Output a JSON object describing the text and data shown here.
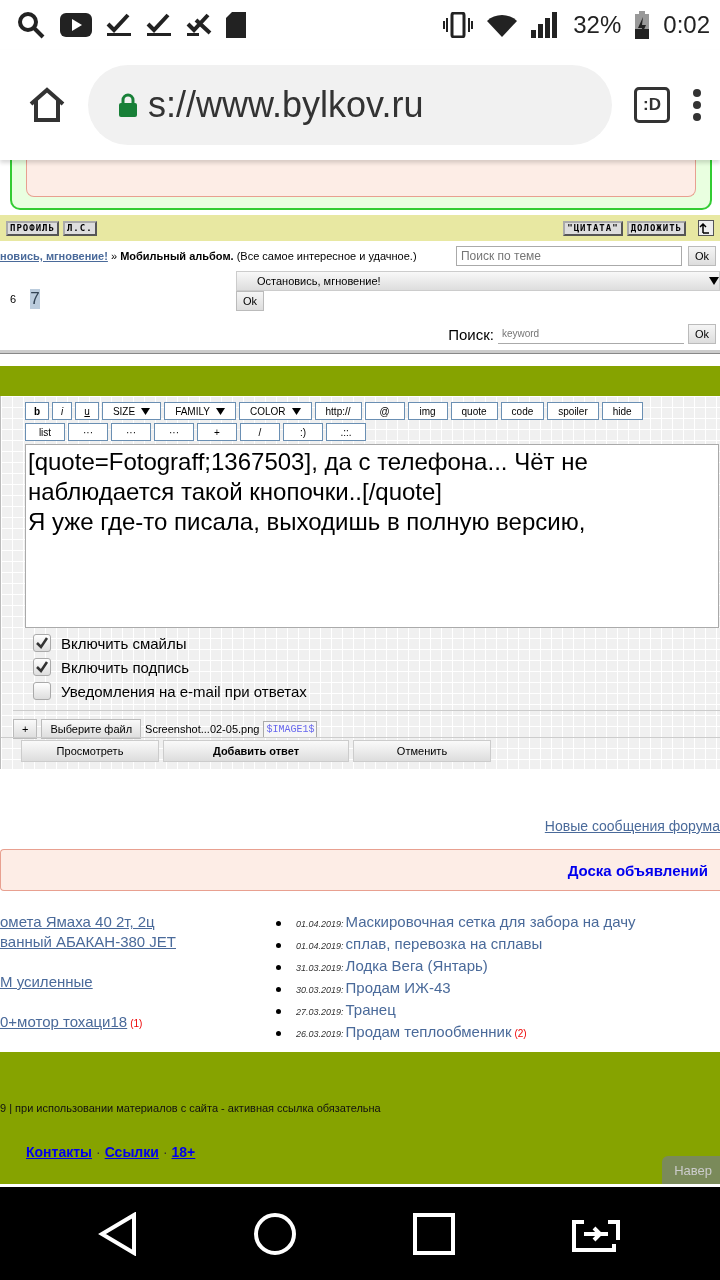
{
  "status_bar": {
    "battery_percent": "32%",
    "time": "0:02"
  },
  "browser": {
    "url": "s://www.bylkov.ru",
    "tabs_label": ":D"
  },
  "topic_bar": {
    "left_buttons": [
      "ПРОФИЛЬ",
      "Л.С."
    ],
    "right_buttons": [
      "\"ЦИТАТА\"",
      "ДОЛОЖИТЬ"
    ]
  },
  "breadcrumb": {
    "link": "новись, мгновение!",
    "separator": "»",
    "current": "Мобильный альбом.",
    "description": "(Все самое интересное и удачное.)"
  },
  "topic_search": {
    "placeholder": "Поиск по теме",
    "button": "Ok"
  },
  "pages": [
    {
      "label": "6",
      "selected": false
    },
    {
      "label": "7",
      "selected": true
    }
  ],
  "forum_jump": {
    "value": "Остановись, мгновение!",
    "button": "Ok"
  },
  "search": {
    "label": "Поиск:",
    "placeholder": "keyword",
    "button": "Ok"
  },
  "editor": {
    "toolbar_row_1": [
      {
        "label": "b",
        "kind": "bold"
      },
      {
        "label": "i",
        "kind": "italic"
      },
      {
        "label": "u",
        "kind": "underline"
      },
      {
        "label": "SIZE",
        "kind": "dropdown"
      },
      {
        "label": "FAMILY",
        "kind": "dropdown"
      },
      {
        "label": "COLOR",
        "kind": "dropdown"
      },
      {
        "label": "http://",
        "kind": "button"
      },
      {
        "label": "@",
        "kind": "button"
      },
      {
        "label": "img",
        "kind": "button"
      },
      {
        "label": "quote",
        "kind": "button"
      },
      {
        "label": "code",
        "kind": "button"
      },
      {
        "label": "spoiler",
        "kind": "button"
      },
      {
        "label": "hide",
        "kind": "button"
      }
    ],
    "toolbar_row_2": [
      {
        "label": "list",
        "kind": "button"
      },
      {
        "label": "···",
        "kind": "button"
      },
      {
        "label": "···",
        "kind": "button"
      },
      {
        "label": "···",
        "kind": "button"
      },
      {
        "label": "+",
        "kind": "button"
      },
      {
        "label": "/",
        "kind": "button"
      },
      {
        "label": ":)",
        "kind": "button"
      },
      {
        "label": ".::.",
        "kind": "button"
      }
    ],
    "message": "[quote=Fotograff;1367503], да с телефона... Чёт не наблюдается такой кнопочки..[/quote]\nЯ уже где-то писала, выходишь в полную версию,",
    "options": [
      {
        "label": "Включить смайлы",
        "checked": true
      },
      {
        "label": "Включить подпись",
        "checked": true
      },
      {
        "label": "Уведомления на e-mail при ответах",
        "checked": false
      }
    ],
    "attach": {
      "add": "+",
      "choose": "Выберите файл",
      "file_name": "Screenshot...02-05.png",
      "tag": "$IMAGE1$"
    },
    "buttons": [
      {
        "label": "Просмотреть",
        "primary": false
      },
      {
        "label": "Добавить ответ",
        "primary": true
      },
      {
        "label": "Отменить",
        "primary": false
      }
    ]
  },
  "new_posts_link": "Новые сообщения форума",
  "board": {
    "title": "Доска объявлений",
    "left_items": [
      {
        "title": "омета Ямаха 40 2т, 2ц"
      },
      {
        "title": "ванный АБАКАН-380 JET"
      },
      {
        "title": "М усиленные"
      },
      {
        "title": "0+мотор тохаци18",
        "count": "(1)"
      }
    ],
    "right_items": [
      {
        "date": "01.04.2019:",
        "title": "Маскировочная сетка для забора на дачу"
      },
      {
        "date": "01.04.2019:",
        "title": "сплав, перевозка на сплавы"
      },
      {
        "date": "31.03.2019:",
        "title": "Лодка Вега (Янтарь)"
      },
      {
        "date": "30.03.2019:",
        "title": "Продам ИЖ-43"
      },
      {
        "date": "27.03.2019:",
        "title": "Транец"
      },
      {
        "date": "26.03.2019:",
        "title": "Продам теплообменник",
        "count": "(2)"
      }
    ]
  },
  "footer": {
    "notice": "9 | при использовании материалов с сайта - активная ссылка обязательна",
    "links": [
      "Контакты",
      "Ссылки",
      "18+"
    ],
    "separator": "·",
    "to_top": "Навер"
  }
}
